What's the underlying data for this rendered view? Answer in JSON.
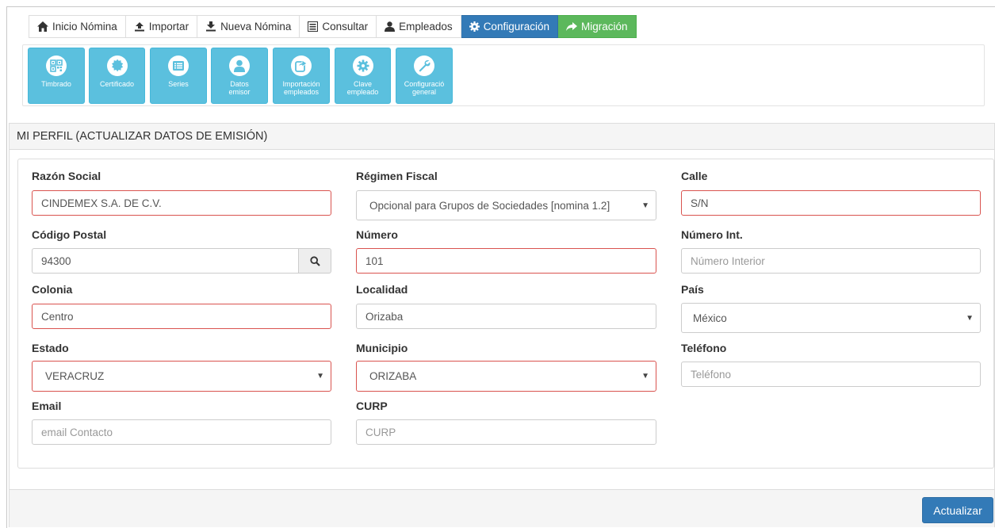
{
  "colors": {
    "primary": "#337ab7",
    "success": "#5cb85c",
    "info": "#5bc0de",
    "error_border": "#d9534f"
  },
  "tabs": [
    {
      "label": "Inicio Nómina",
      "icon": "home-icon"
    },
    {
      "label": "Importar",
      "icon": "upload-icon"
    },
    {
      "label": "Nueva Nómina",
      "icon": "download-icon"
    },
    {
      "label": "Consultar",
      "icon": "list-icon"
    },
    {
      "label": "Empleados",
      "icon": "user-icon"
    },
    {
      "label": "Configuración",
      "icon": "gear-icon",
      "active": true
    },
    {
      "label": "Migración",
      "icon": "share-arrow-icon"
    }
  ],
  "tiles": [
    {
      "label": "Timbrado",
      "icon": "qrcode-icon"
    },
    {
      "label": "Certificado",
      "icon": "certificate-icon"
    },
    {
      "label": "Series",
      "icon": "list-icon"
    },
    {
      "label": "Datos\nemisor",
      "icon": "user-icon"
    },
    {
      "label": "Importación\nempleados",
      "icon": "share-icon"
    },
    {
      "label": "Clave\nempleado",
      "icon": "gear-icon"
    },
    {
      "label": "Configuració\ngeneral",
      "icon": "wrench-icon"
    }
  ],
  "panel": {
    "title": "MI PERFIL (ACTUALIZAR DATOS DE EMISIÓN)"
  },
  "form": {
    "razon_social": {
      "label": "Razón Social",
      "value": "CINDEMEX S.A. DE C.V."
    },
    "regimen_fiscal": {
      "label": "Régimen Fiscal",
      "value": "Opcional para Grupos de Sociedades [nomina 1.2]"
    },
    "calle": {
      "label": "Calle",
      "value": "S/N"
    },
    "codigo_postal": {
      "label": "Código Postal",
      "value": "94300"
    },
    "numero": {
      "label": "Número",
      "value": "101"
    },
    "numero_int": {
      "label": "Número Int.",
      "placeholder": "Número Interior"
    },
    "colonia": {
      "label": "Colonia",
      "value": "Centro"
    },
    "localidad": {
      "label": "Localidad",
      "value": "Orizaba"
    },
    "pais": {
      "label": "País",
      "value": "México"
    },
    "estado": {
      "label": "Estado",
      "value": "VERACRUZ"
    },
    "municipio": {
      "label": "Municipio",
      "value": "ORIZABA"
    },
    "telefono": {
      "label": "Teléfono",
      "placeholder": "Teléfono"
    },
    "email": {
      "label": "Email",
      "placeholder": "email Contacto"
    },
    "curp": {
      "label": "CURP",
      "placeholder": "CURP"
    }
  },
  "footer": {
    "update_label": "Actualizar"
  }
}
